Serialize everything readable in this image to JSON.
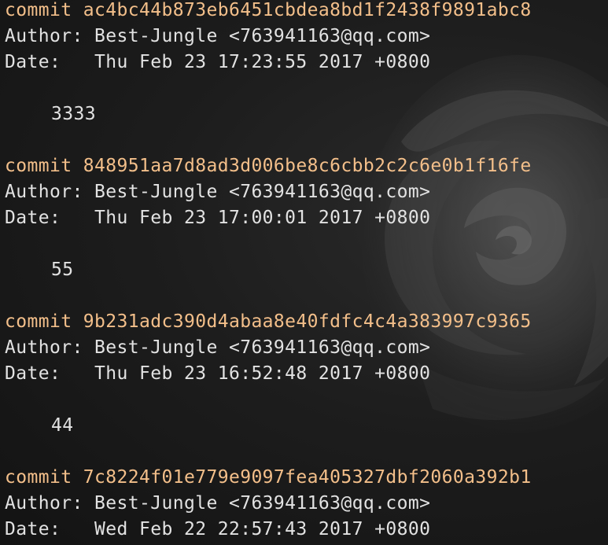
{
  "terminal": {
    "commits": [
      {
        "commit_line": "commit ac4bc44b873eb6451cbdea8bd1f2438f9891abc8",
        "author_line": "Author: Best-Jungle <763941163@qq.com>",
        "date_line": "Date:   Thu Feb 23 17:23:55 2017 +0800",
        "message": "3333"
      },
      {
        "commit_line": "commit 848951aa7d8ad3d006be8c6cbb2c2c6e0b1f16fe",
        "author_line": "Author: Best-Jungle <763941163@qq.com>",
        "date_line": "Date:   Thu Feb 23 17:00:01 2017 +0800",
        "message": "55"
      },
      {
        "commit_line": "commit 9b231adc390d4abaa8e40fdfc4c4a383997c9365",
        "author_line": "Author: Best-Jungle <763941163@qq.com>",
        "date_line": "Date:   Thu Feb 23 16:52:48 2017 +0800",
        "message": "44"
      },
      {
        "commit_line": "commit 7c8224f01e779e9097fea405327dbf2060a392b1",
        "author_line": "Author: Best-Jungle <763941163@qq.com>",
        "date_line": "Date:   Wed Feb 22 22:57:43 2017 +0800",
        "message": ""
      }
    ]
  },
  "colors": {
    "background": "#161616",
    "commit_hash": "#f3bf8a",
    "text": "#e2e2e2"
  }
}
